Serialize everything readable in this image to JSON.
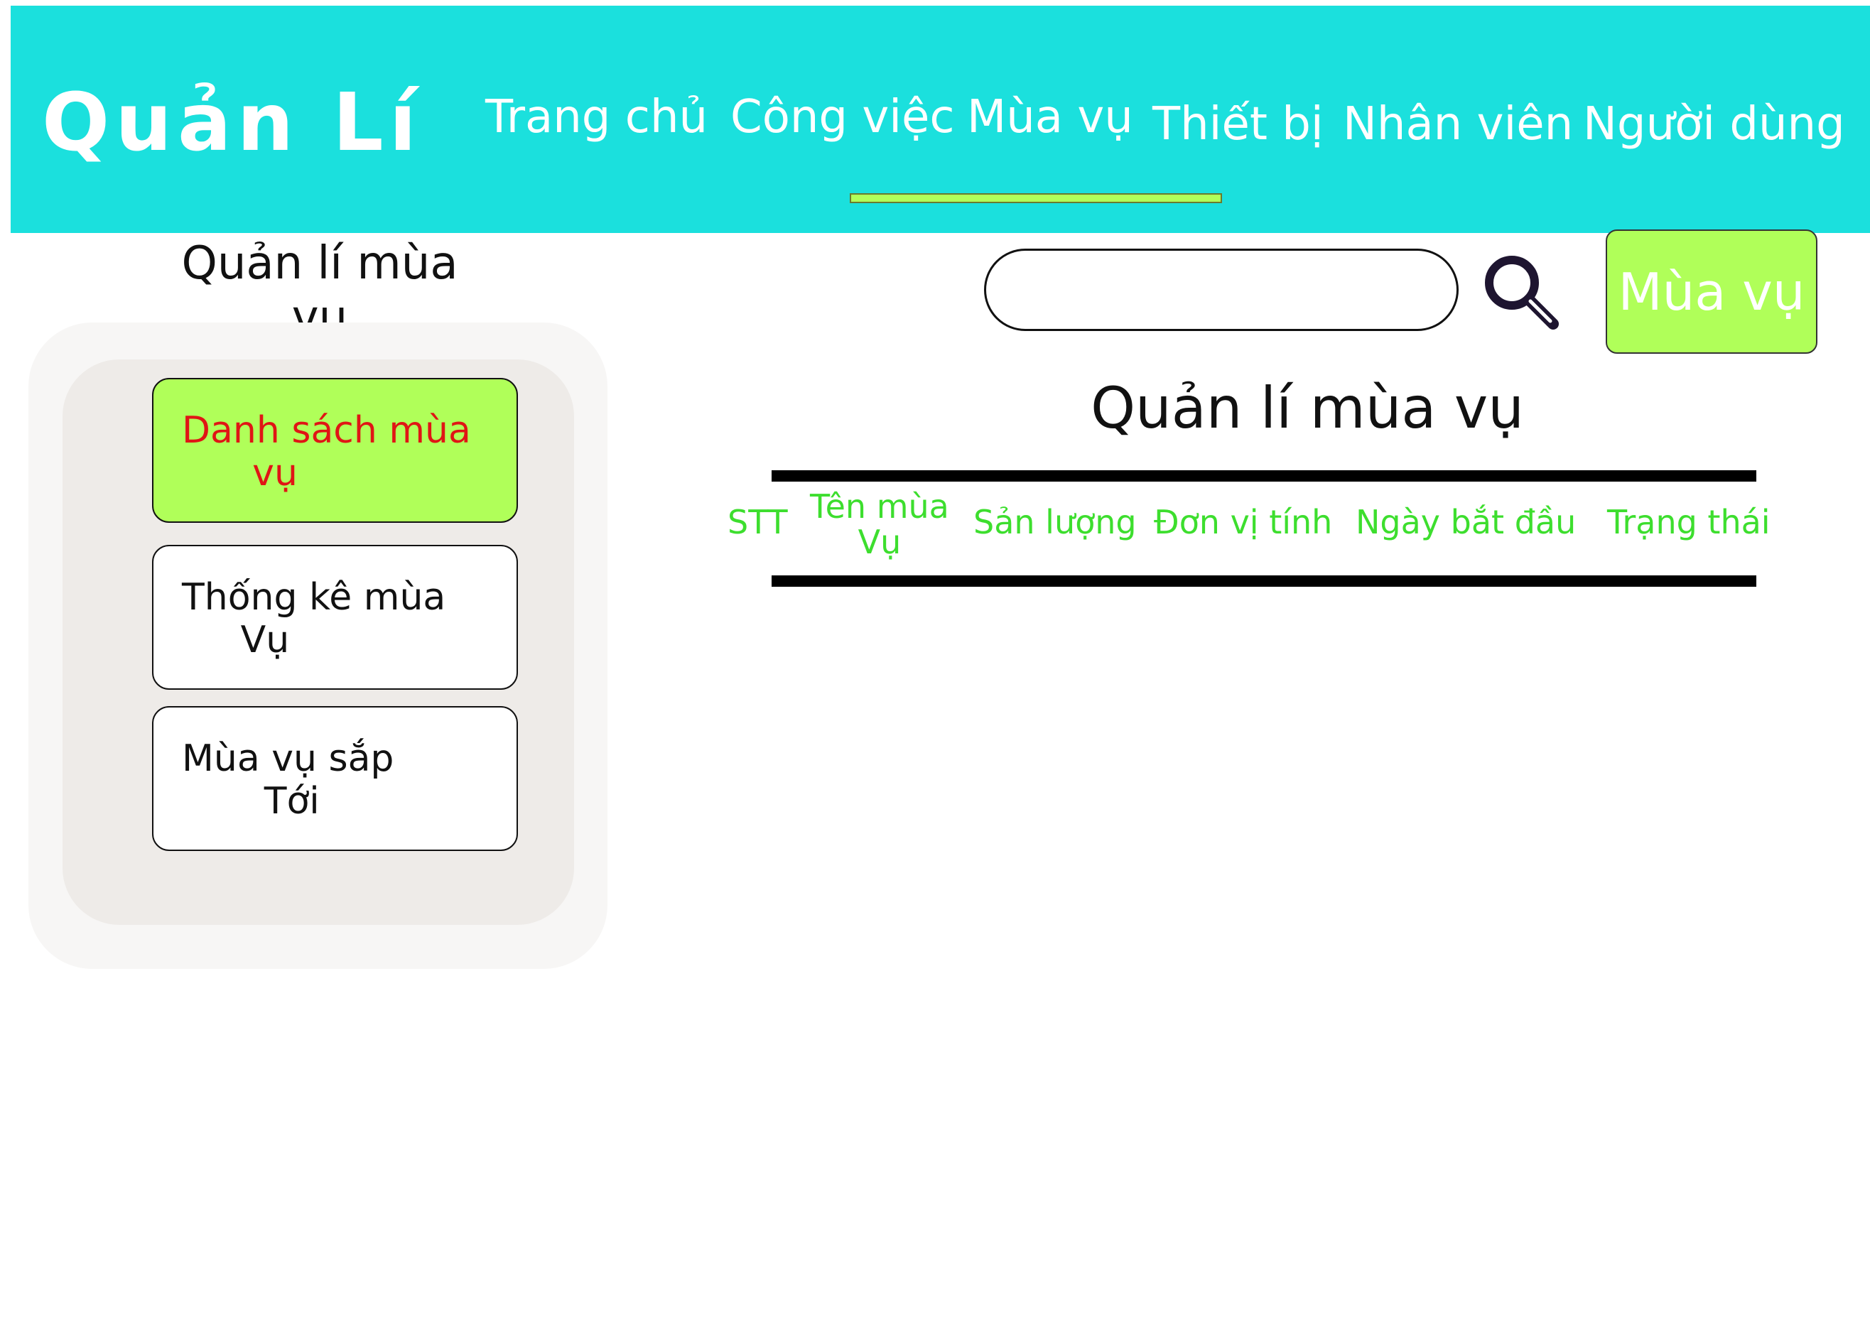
{
  "header": {
    "brand": "Quản Lí",
    "nav": [
      {
        "label": "Trang chủ"
      },
      {
        "label": "Công việc"
      },
      {
        "label": "Mùa vụ"
      },
      {
        "label": "Thiết bị"
      },
      {
        "label": "Nhân viên"
      },
      {
        "label": "Người dùng"
      }
    ],
    "active_nav": "Mùa vụ"
  },
  "sidebar": {
    "title": "Quản lí mùa\nvụ",
    "items": [
      {
        "label": "Danh sách mùa\n      vụ",
        "active": true
      },
      {
        "label": "Thống kê mùa\n     Vụ",
        "active": false
      },
      {
        "label": "Mùa vụ sắp\n       Tới",
        "active": false
      }
    ]
  },
  "search": {
    "placeholder": "",
    "value": "",
    "icon": "magnifier-icon"
  },
  "season_button": {
    "label": "Mùa vụ"
  },
  "main": {
    "title": "Quản lí mùa vụ",
    "table": {
      "columns": [
        "STT",
        "Tên mùa\nVụ",
        "Sản lượng",
        "Đơn vị tính",
        "Ngày bắt đầu",
        "Trạng thái"
      ],
      "rows": []
    }
  },
  "colors": {
    "header_bg": "#1be0dd",
    "accent_green": "#b0ff59",
    "column_text": "#3dde2e",
    "active_item_text": "#e01515"
  }
}
